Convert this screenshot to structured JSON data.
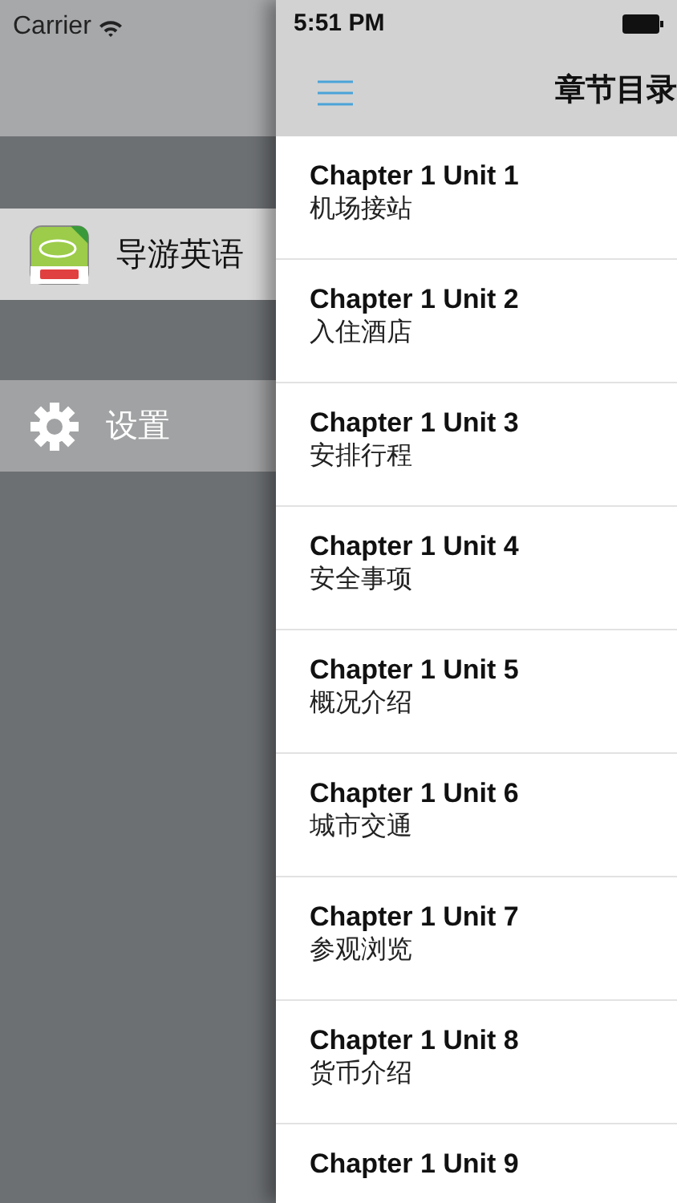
{
  "left_status": {
    "carrier": "Carrier"
  },
  "menu": [
    {
      "kind": "app",
      "label": "导游英语",
      "selected": true
    },
    {
      "kind": "settings",
      "label": "设置",
      "selected": false
    }
  ],
  "status_bar": {
    "time": "5:51 PM"
  },
  "nav": {
    "title": "章节目录"
  },
  "chapters": [
    {
      "title": "Chapter 1 Unit 1",
      "subtitle": "机场接站"
    },
    {
      "title": "Chapter 1 Unit 2",
      "subtitle": "入住酒店"
    },
    {
      "title": "Chapter 1 Unit 3",
      "subtitle": "安排行程"
    },
    {
      "title": "Chapter 1 Unit 4",
      "subtitle": "安全事项"
    },
    {
      "title": "Chapter 1 Unit 5",
      "subtitle": "概况介绍"
    },
    {
      "title": "Chapter 1 Unit 6",
      "subtitle": "城市交通"
    },
    {
      "title": "Chapter 1 Unit 7",
      "subtitle": "参观浏览"
    },
    {
      "title": "Chapter 1 Unit 8",
      "subtitle": "货币介绍"
    },
    {
      "title": "Chapter 1 Unit 9"
    }
  ]
}
